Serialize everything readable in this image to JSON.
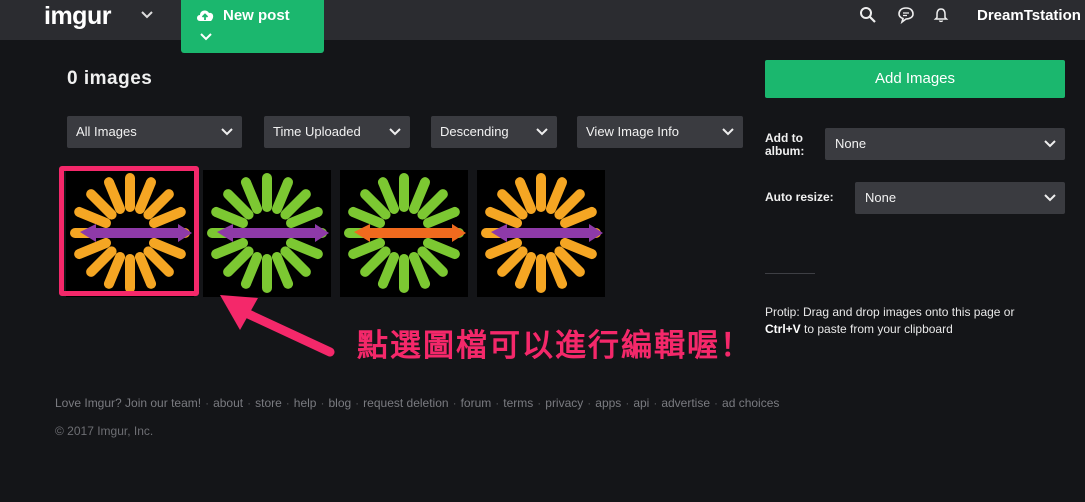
{
  "header": {
    "logo": "imgur",
    "new_post_label": "New post",
    "username": "DreamTstation",
    "icons": [
      "search-icon",
      "chat-icon",
      "bell-icon"
    ]
  },
  "main": {
    "image_count": "0 images",
    "filters": [
      {
        "label": "All Images"
      },
      {
        "label": "Time Uploaded"
      },
      {
        "label": "Descending"
      },
      {
        "label": "View Image Info"
      }
    ],
    "thumbnails": [
      {
        "spoke_color": "#f5a623",
        "bar_color": "#8e3aa8",
        "selected": true
      },
      {
        "spoke_color": "#7cc832",
        "bar_color": "#8e3aa8",
        "selected": false
      },
      {
        "spoke_color": "#7cc832",
        "bar_color": "#f06a1e",
        "selected": false
      },
      {
        "spoke_color": "#f5a623",
        "bar_color": "#8e3aa8",
        "selected": false
      }
    ],
    "annotation_text": "點選圖檔可以進行編輯喔！",
    "annotation_color": "#f4286a"
  },
  "sidebar": {
    "add_images_label": "Add Images",
    "album_label_line1": "Add to",
    "album_label_line2": "album:",
    "album_value": "None",
    "resize_label": "Auto resize:",
    "resize_value": "None",
    "protip_lead": "Protip: Drag and drop images onto this page or",
    "protip_key": "Ctrl+V",
    "protip_tail": " to paste from your clipboard"
  },
  "footer": {
    "links": [
      "Love Imgur? Join our team!",
      "about",
      "store",
      "help",
      "blog",
      "request deletion",
      "forum",
      "terms",
      "privacy",
      "apps",
      "api",
      "advertise",
      "ad choices"
    ],
    "copyright": "© 2017 Imgur, Inc."
  },
  "colors": {
    "accent": "#1bb76e",
    "topbar": "#2b2c30",
    "background": "#141518"
  }
}
